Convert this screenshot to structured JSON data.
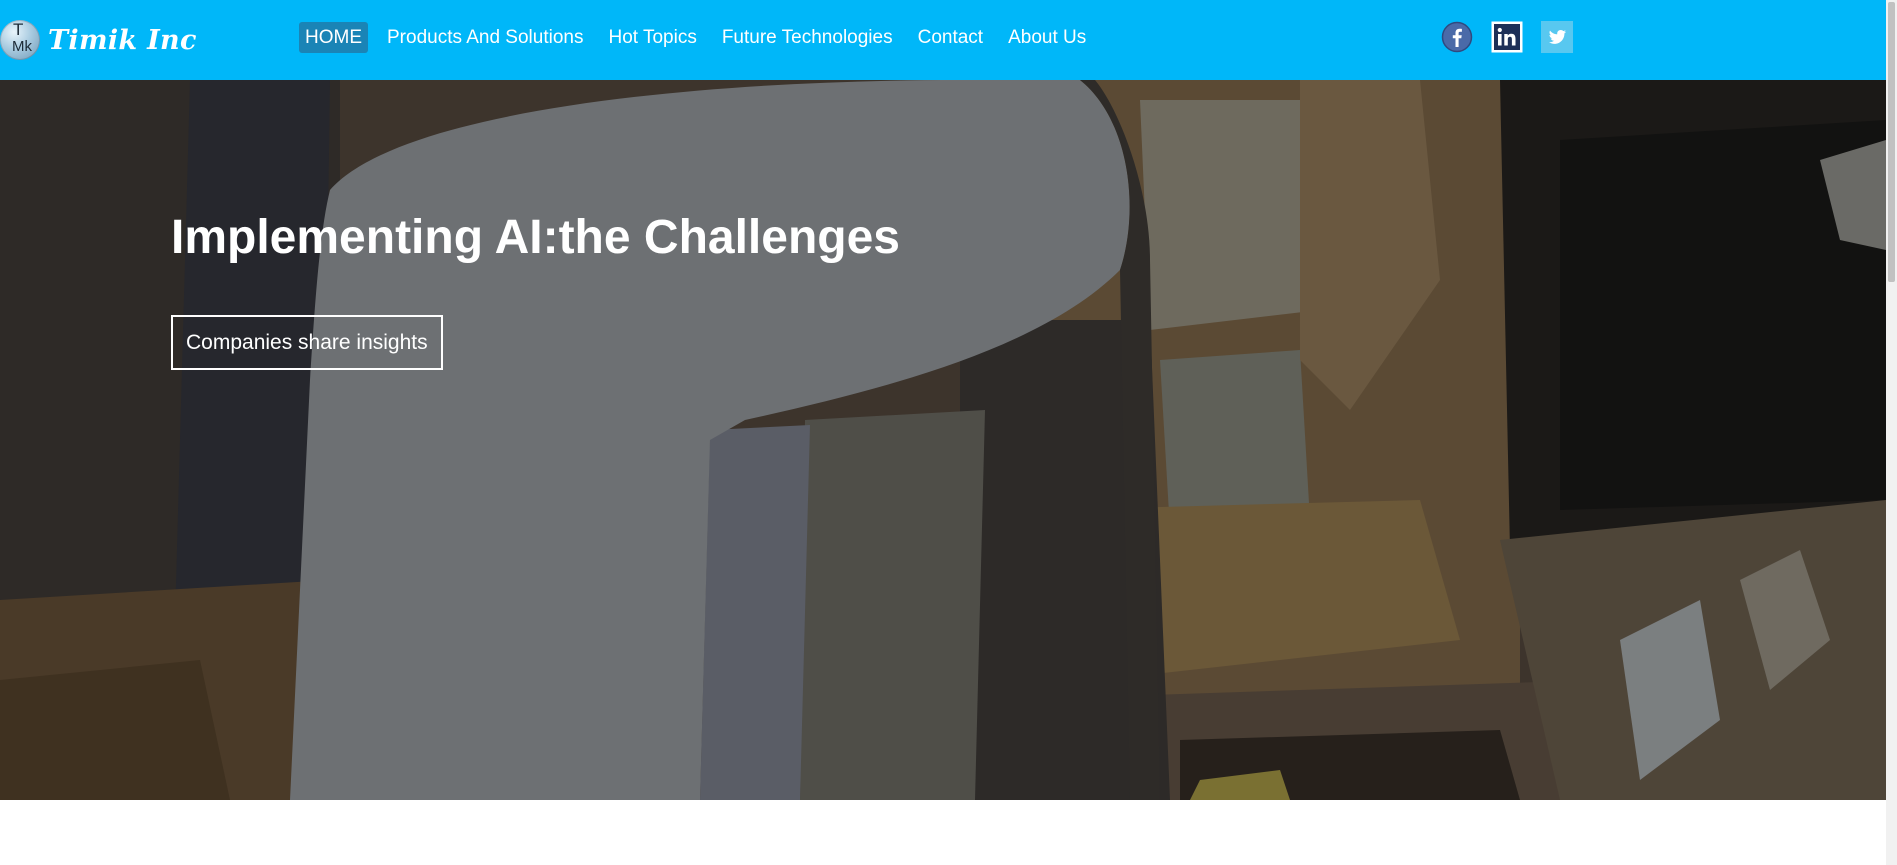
{
  "brand": {
    "name": "Timik Inc",
    "mark_top": "T",
    "mark_bottom": "Mk"
  },
  "nav": {
    "items": [
      {
        "label": "HOME",
        "active": true
      },
      {
        "label": "Products And Solutions",
        "active": false
      },
      {
        "label": "Hot Topics",
        "active": false
      },
      {
        "label": "Future Technologies",
        "active": false
      },
      {
        "label": "Contact",
        "active": false
      },
      {
        "label": "About Us",
        "active": false
      }
    ]
  },
  "social": [
    {
      "icon": "facebook-icon"
    },
    {
      "icon": "linkedin-icon"
    },
    {
      "icon": "twitter-icon"
    }
  ],
  "hero": {
    "title": "Implementing AI:the Challenges",
    "button_label": "Companies share insights"
  },
  "colors": {
    "header_bg": "#00b7f9",
    "nav_active_bg": "#1a84b6",
    "hero_text": "#ffffff"
  }
}
